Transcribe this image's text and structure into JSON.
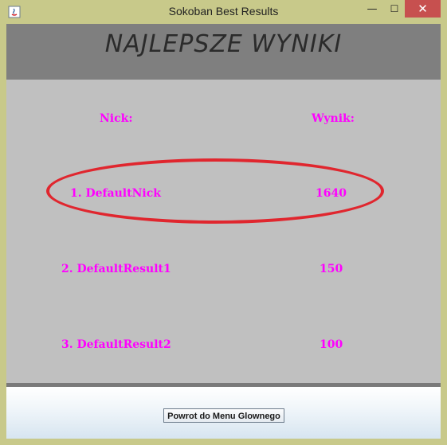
{
  "window": {
    "title": "Sokoban Best Results",
    "minimize_glyph": "—",
    "maximize_glyph": "☐",
    "close_glyph": "✕",
    "app_icon": "java-app-icon"
  },
  "header": {
    "title": "NAJLEPSZE WYNIKI"
  },
  "results": {
    "nick_header": "Nick:",
    "score_header": "Wynik:",
    "rows": [
      {
        "nick": "1. DefaultNick",
        "score": "1640"
      },
      {
        "nick": "2. DefaultResult1",
        "score": "150"
      },
      {
        "nick": "3. DefaultResult2",
        "score": "100"
      }
    ]
  },
  "footer": {
    "back_button_label": "Powrot do Menu Glownego"
  },
  "colors": {
    "text_accent": "#ff00ff",
    "highlight_ellipse": "#e0262e",
    "header_bg": "#7f7f7f",
    "panel_bg": "#c0c0c0",
    "window_frame": "#c8c98a",
    "close_button": "#c7504f"
  }
}
